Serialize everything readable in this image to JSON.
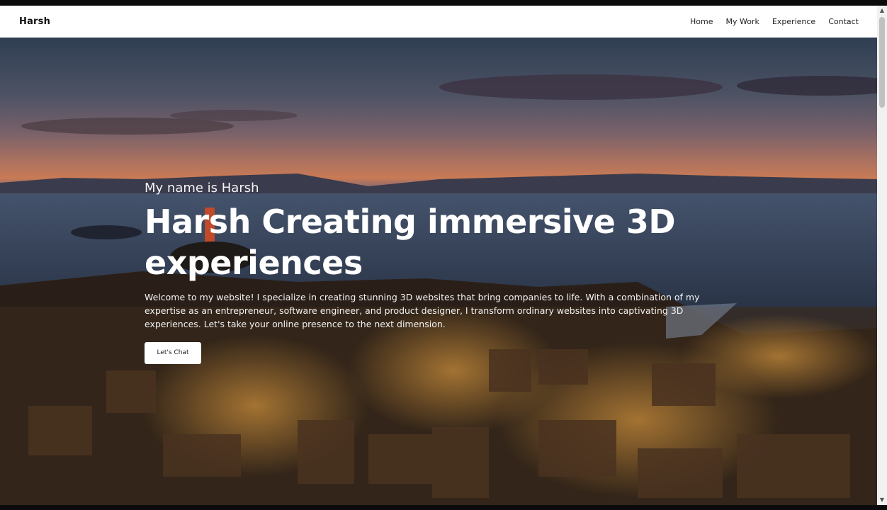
{
  "nav": {
    "brand": "Harsh",
    "links": [
      "Home",
      "My Work",
      "Experience",
      "Contact"
    ]
  },
  "hero": {
    "eyebrow": "My name is Harsh",
    "headline": "Harsh Creating immersive 3D experiences",
    "description": "Welcome to my website! I specialize in creating stunning 3D websites that bring companies to life. With a combination of my expertise as an entrepreneur, software engineer, and product designer, I transform ordinary websites into captivating 3D experiences. Let's take your online presence to the next dimension.",
    "cta_label": "Let's Chat"
  },
  "scrollbar": {
    "up_icon": "triangle-up",
    "down_icon": "triangle-down"
  }
}
